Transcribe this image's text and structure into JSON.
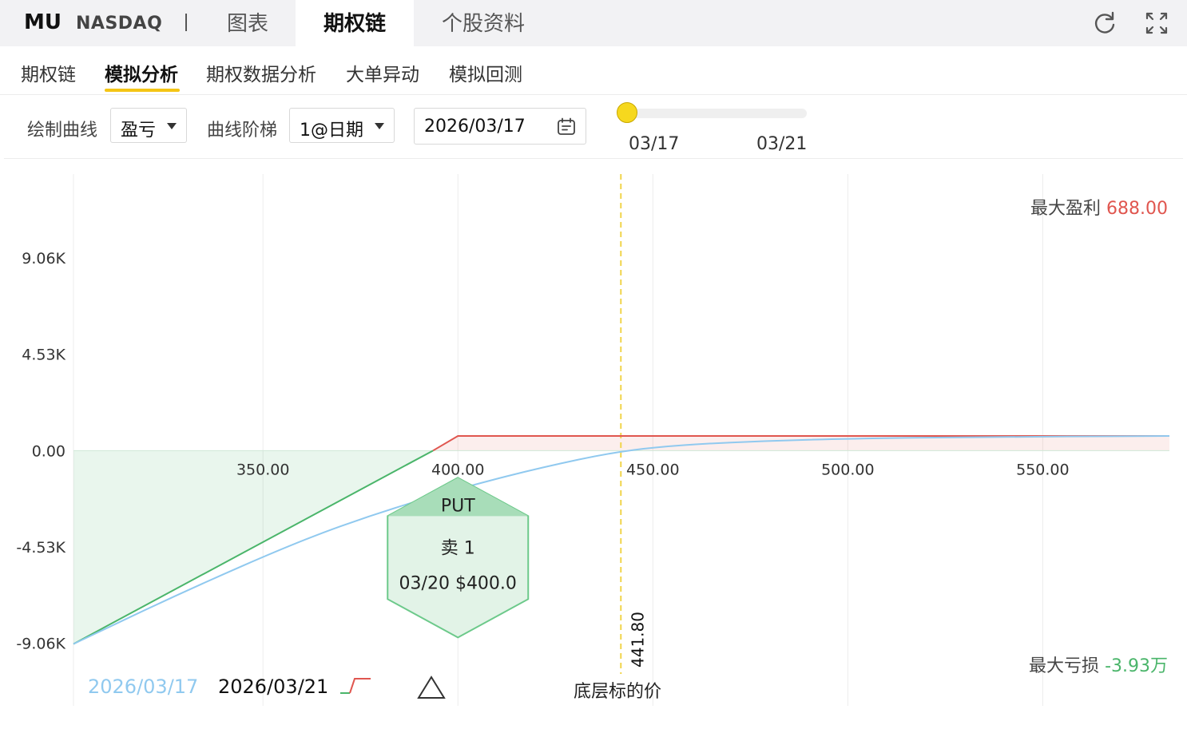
{
  "header": {
    "ticker": "MU",
    "exchange": "NASDAQ",
    "tabs": [
      {
        "label": "图表",
        "active": false
      },
      {
        "label": "期权链",
        "active": true
      },
      {
        "label": "个股资料",
        "active": false
      }
    ],
    "icons": [
      "refresh-icon",
      "fullscreen-icon"
    ]
  },
  "subtabs": [
    {
      "label": "期权链",
      "active": false
    },
    {
      "label": "模拟分析",
      "active": true
    },
    {
      "label": "期权数据分析",
      "active": false
    },
    {
      "label": "大单异动",
      "active": false
    },
    {
      "label": "模拟回测",
      "active": false
    }
  ],
  "controls": {
    "curve_label": "绘制曲线",
    "curve_value": "盈亏",
    "ladder_label": "曲线阶梯",
    "ladder_value": "1@日期",
    "date_value": "2026/03/17",
    "slider_start": "03/17",
    "slider_end": "03/21",
    "slider_position": 0
  },
  "colors": {
    "profit": "#e0564f",
    "loss": "#4ab56a",
    "current_curve": "#90c9ef",
    "underlying_line": "#f1d44a",
    "accent": "#f4c515"
  },
  "summary": {
    "max_profit_label": "最大盈利",
    "max_profit_value": "688.00",
    "max_loss_label": "最大亏损",
    "max_loss_value": "-3.93万"
  },
  "legend": {
    "current": "2026/03/17",
    "expiry": "2026/03/21",
    "underlying": "底层标的价"
  },
  "chart_data": {
    "type": "line",
    "title": "",
    "xlabel": "",
    "ylabel": "",
    "x_ticks": [
      350,
      400,
      450,
      500,
      550
    ],
    "x_tick_labels": [
      "350.00",
      "400.00",
      "450.00",
      "500.00",
      "550.00"
    ],
    "y_tick_labels": [
      "9.06K",
      "4.53K",
      "0.00",
      "-4.53K",
      "-9.06K"
    ],
    "y_ticks": [
      9060,
      4530,
      0,
      -4530,
      -9060
    ],
    "xlim": [
      301.4,
      582.5
    ],
    "ylim": [
      -12000,
      13000
    ],
    "grid": true,
    "underlying_price": 441.8,
    "underlying_label": "441.80",
    "series": [
      {
        "name": "2026/03/21",
        "color": "#e0564f",
        "x": [
          301.4,
          393,
          400,
          582.5
        ],
        "y": [
          -9090,
          -68,
          688,
          688
        ]
      },
      {
        "name": "2026/03/17",
        "color": "#90c9ef",
        "x": [
          301.4,
          330,
          360,
          380,
          400,
          420,
          441.8,
          460,
          480,
          500,
          530,
          582.5
        ],
        "y": [
          -9090,
          -6600,
          -4200,
          -2900,
          -1800,
          -850,
          0,
          300,
          460,
          560,
          640,
          688
        ]
      }
    ],
    "annotation": {
      "type": "PUT",
      "action": "卖 1",
      "detail": "03/20 $400.0",
      "strike": 400
    }
  }
}
